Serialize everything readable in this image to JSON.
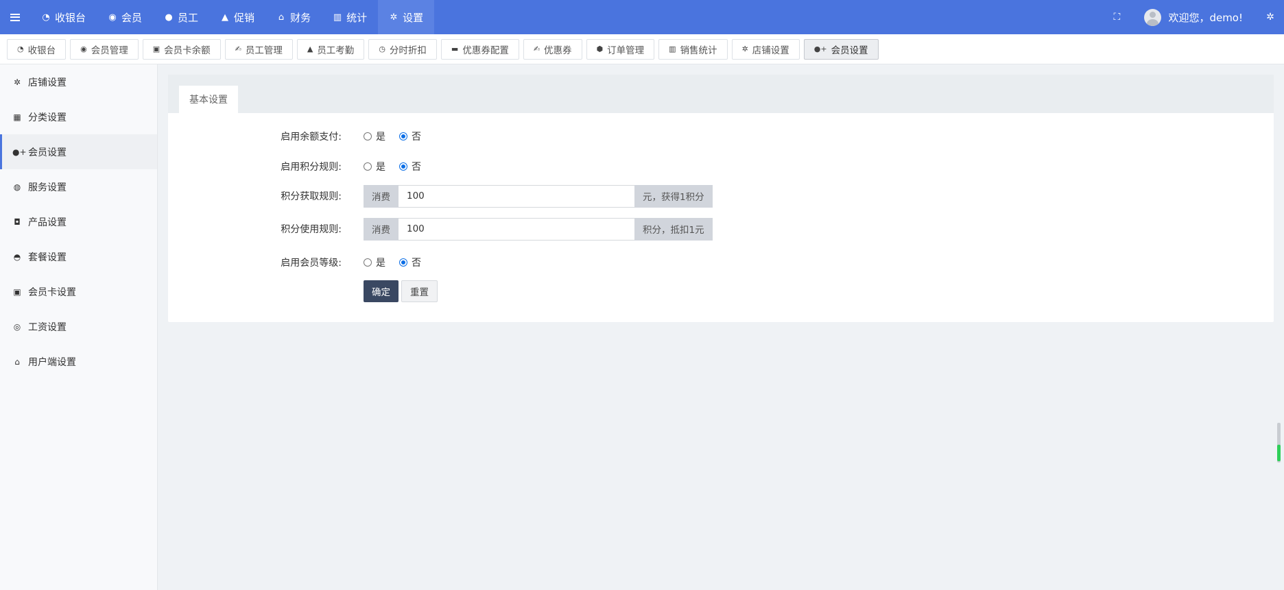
{
  "topnav": {
    "items": [
      {
        "label": "收银台",
        "icon": "dashboard-icon"
      },
      {
        "label": "会员",
        "icon": "user-circle-icon"
      },
      {
        "label": "员工",
        "icon": "users-icon"
      },
      {
        "label": "促销",
        "icon": "bell-icon"
      },
      {
        "label": "财务",
        "icon": "bank-icon"
      },
      {
        "label": "统计",
        "icon": "bar-chart-icon"
      },
      {
        "label": "设置",
        "icon": "cogs-icon",
        "active": true
      }
    ],
    "welcome": "欢迎您，demo!"
  },
  "tabs": [
    {
      "label": "收银台",
      "icon": "dashboard-icon"
    },
    {
      "label": "会员管理",
      "icon": "user-circle-icon"
    },
    {
      "label": "会员卡余额",
      "icon": "id-card-icon"
    },
    {
      "label": "员工管理",
      "icon": "handshake-icon"
    },
    {
      "label": "员工考勤",
      "icon": "bell-icon"
    },
    {
      "label": "分时折扣",
      "icon": "clock-icon"
    },
    {
      "label": "优惠券配置",
      "icon": "visa-card-icon"
    },
    {
      "label": "优惠券",
      "icon": "handshake-icon"
    },
    {
      "label": "订单管理",
      "icon": "cube-icon"
    },
    {
      "label": "销售统计",
      "icon": "bar-chart-icon"
    },
    {
      "label": "店铺设置",
      "icon": "gear-icon"
    },
    {
      "label": "会员设置",
      "icon": "user-plus-icon",
      "active": true
    }
  ],
  "sidebar": {
    "items": [
      {
        "label": "店铺设置",
        "icon": "gear-icon"
      },
      {
        "label": "分类设置",
        "icon": "calculator-icon"
      },
      {
        "label": "会员设置",
        "icon": "user-plus-icon",
        "active": true
      },
      {
        "label": "服务设置",
        "icon": "globe-icon"
      },
      {
        "label": "产品设置",
        "icon": "shopping-bag-icon"
      },
      {
        "label": "套餐设置",
        "icon": "chevron-circle-up-icon"
      },
      {
        "label": "会员卡设置",
        "icon": "id-card-icon"
      },
      {
        "label": "工资设置",
        "icon": "chrome-icon"
      },
      {
        "label": "用户端设置",
        "icon": "bank-icon"
      }
    ]
  },
  "card": {
    "tab_label": "基本设置"
  },
  "form": {
    "balance_pay": {
      "label": "启用余额支付:",
      "options": [
        "是",
        "否"
      ],
      "selected": "否"
    },
    "points_rule": {
      "label": "启用积分规则:",
      "options": [
        "是",
        "否"
      ],
      "selected": "否"
    },
    "points_earn": {
      "label": "积分获取规则:",
      "prefix": "消费",
      "value": "100",
      "suffix": "元，获得1积分"
    },
    "points_use": {
      "label": "积分使用规则:",
      "prefix": "消费",
      "value": "100",
      "suffix": "积分，抵扣1元"
    },
    "member_level": {
      "label": "启用会员等级:",
      "options": [
        "是",
        "否"
      ],
      "selected": "否"
    },
    "confirm_label": "确定",
    "reset_label": "重置"
  }
}
